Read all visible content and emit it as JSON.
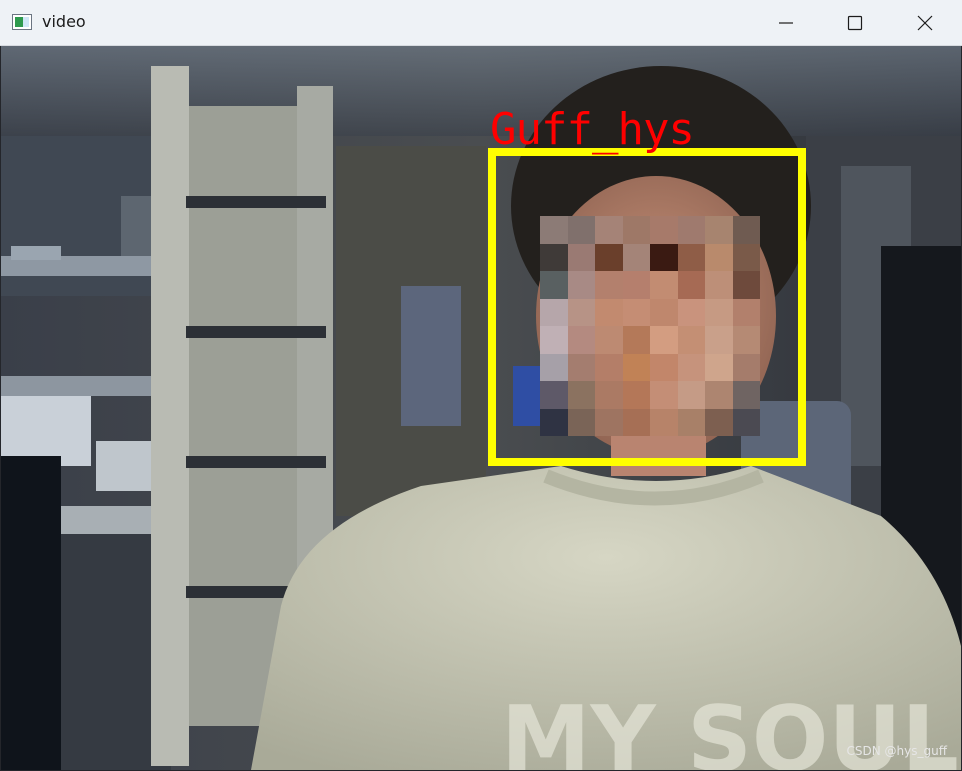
{
  "window": {
    "title": "video",
    "icon": "opencv-window-icon",
    "controls": {
      "minimize": "minimize-icon",
      "maximize": "maximize-icon",
      "close": "close-icon"
    }
  },
  "video": {
    "detection_label": "Guff_hys",
    "box_color": "#ffff00",
    "label_color": "#ff0000",
    "shirt_text": "MY SOUL",
    "watermark": "CSDN @hys_guff"
  }
}
